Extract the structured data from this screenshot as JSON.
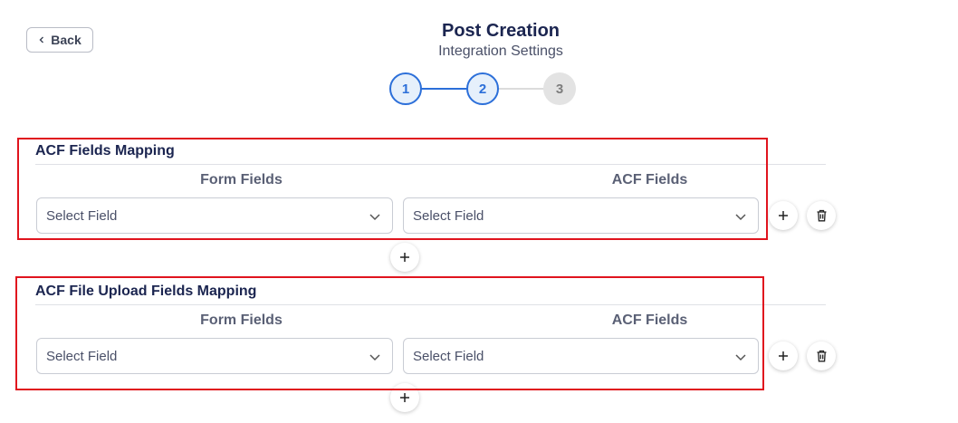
{
  "header": {
    "back_label": "Back",
    "title": "Post Creation",
    "subtitle": "Integration Settings"
  },
  "stepper": {
    "steps": [
      {
        "label": "1",
        "state": "active"
      },
      {
        "label": "2",
        "state": "active"
      },
      {
        "label": "3",
        "state": "inactive"
      }
    ],
    "current_step": 2
  },
  "sections": [
    {
      "title": "ACF Fields Mapping",
      "col_left": "Form Fields",
      "col_right": "ACF Fields",
      "left_select": "Select Field",
      "right_select": "Select Field"
    },
    {
      "title": "ACF File Upload Fields Mapping",
      "col_left": "Form Fields",
      "col_right": "ACF Fields",
      "left_select": "Select Field",
      "right_select": "Select Field"
    }
  ],
  "icons": {
    "back": "chevron-left-icon",
    "add": "plus-icon",
    "delete": "trash-icon",
    "dropdown": "chevron-down-icon"
  },
  "colors": {
    "accent": "#2c6fd9",
    "highlight": "#e0141e",
    "title": "#1b2550"
  }
}
